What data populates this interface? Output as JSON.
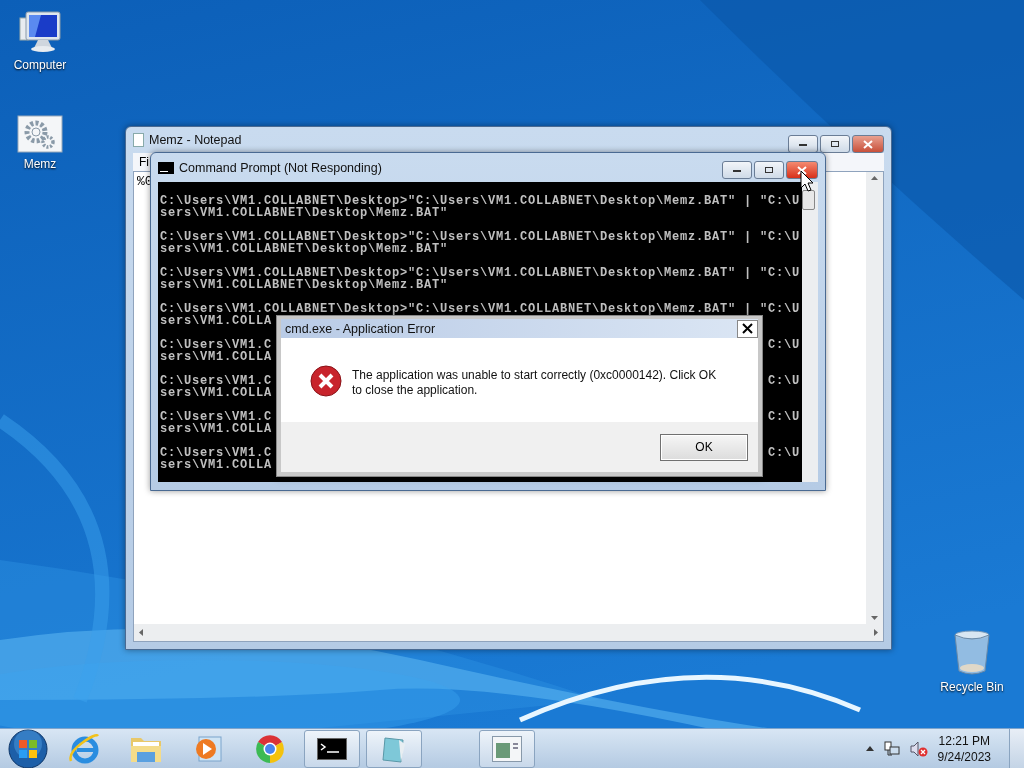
{
  "desktop_icons": [
    {
      "label": "Computer",
      "kind": "computer"
    },
    {
      "label": "Memz",
      "kind": "settings"
    },
    {
      "label": "Recycle Bin",
      "kind": "recycle"
    }
  ],
  "notepad": {
    "title": "Memz - Notepad",
    "menu": [
      "Fi"
    ],
    "text": "%0"
  },
  "command_prompt": {
    "title": "Command Prompt (Not Responding)",
    "entries": [
      {
        "lines": [
          {
            "text": "C:\\Users\\VM1.COLLABNET\\Desktop>\"C:\\Users\\VM1.COLLABNET\\Desktop\\Memz.BAT\" | \"C:\\U"
          },
          {
            "text": "sers\\VM1.COLLABNET\\Desktop\\Memz.BAT\""
          }
        ]
      },
      {
        "lines": [
          {
            "text": "C:\\Users\\VM1.COLLABNET\\Desktop>\"C:\\Users\\VM1.COLLABNET\\Desktop\\Memz.BAT\" | \"C:\\U"
          },
          {
            "text": "sers\\VM1.COLLABNET\\Desktop\\Memz.BAT\""
          }
        ]
      },
      {
        "lines": [
          {
            "text": "C:\\Users\\VM1.COLLABNET\\Desktop>\"C:\\Users\\VM1.COLLABNET\\Desktop\\Memz.BAT\" | \"C:\\U"
          },
          {
            "text": "sers\\VM1.COLLABNET\\Desktop\\Memz.BAT\""
          }
        ]
      },
      {
        "lines": [
          {
            "text": "C:\\Users\\VM1.COLLABNET\\Desktop>\"C:\\Users\\VM1.COLLABNET\\Desktop\\Memz.BAT\" | \"C:\\U"
          },
          {
            "text": "sers\\VM1.COLLA"
          }
        ]
      },
      {
        "lines": [
          {
            "text": "C:\\Users\\VM1.C",
            "tail": "C:\\U"
          },
          {
            "text": "sers\\VM1.COLLA"
          }
        ]
      },
      {
        "lines": [
          {
            "text": "C:\\Users\\VM1.C",
            "tail": "C:\\U"
          },
          {
            "text": "sers\\VM1.COLLA"
          }
        ]
      },
      {
        "lines": [
          {
            "text": "C:\\Users\\VM1.C",
            "tail": "C:\\U"
          },
          {
            "text": "sers\\VM1.COLLA"
          }
        ]
      },
      {
        "lines": [
          {
            "text": "C:\\Users\\VM1.C",
            "tail": "C:\\U"
          },
          {
            "text": "sers\\VM1.COLLA"
          }
        ]
      }
    ]
  },
  "error_dialog": {
    "title": "cmd.exe - Application Error",
    "message": "The application was unable to start correctly (0xc0000142). Click OK to close the application.",
    "buttons": [
      "OK"
    ]
  },
  "taskbar": {
    "items": [
      {
        "kind": "start",
        "open": false
      },
      {
        "kind": "browser",
        "open": false
      },
      {
        "kind": "folder",
        "open": false
      },
      {
        "kind": "media",
        "open": false
      },
      {
        "kind": "chrome",
        "open": false
      },
      {
        "kind": "terminal",
        "open": true
      },
      {
        "kind": "notepad",
        "open": true
      },
      {
        "kind": "window",
        "open": true
      }
    ],
    "time": "12:21 PM",
    "date": "9/24/2023"
  }
}
